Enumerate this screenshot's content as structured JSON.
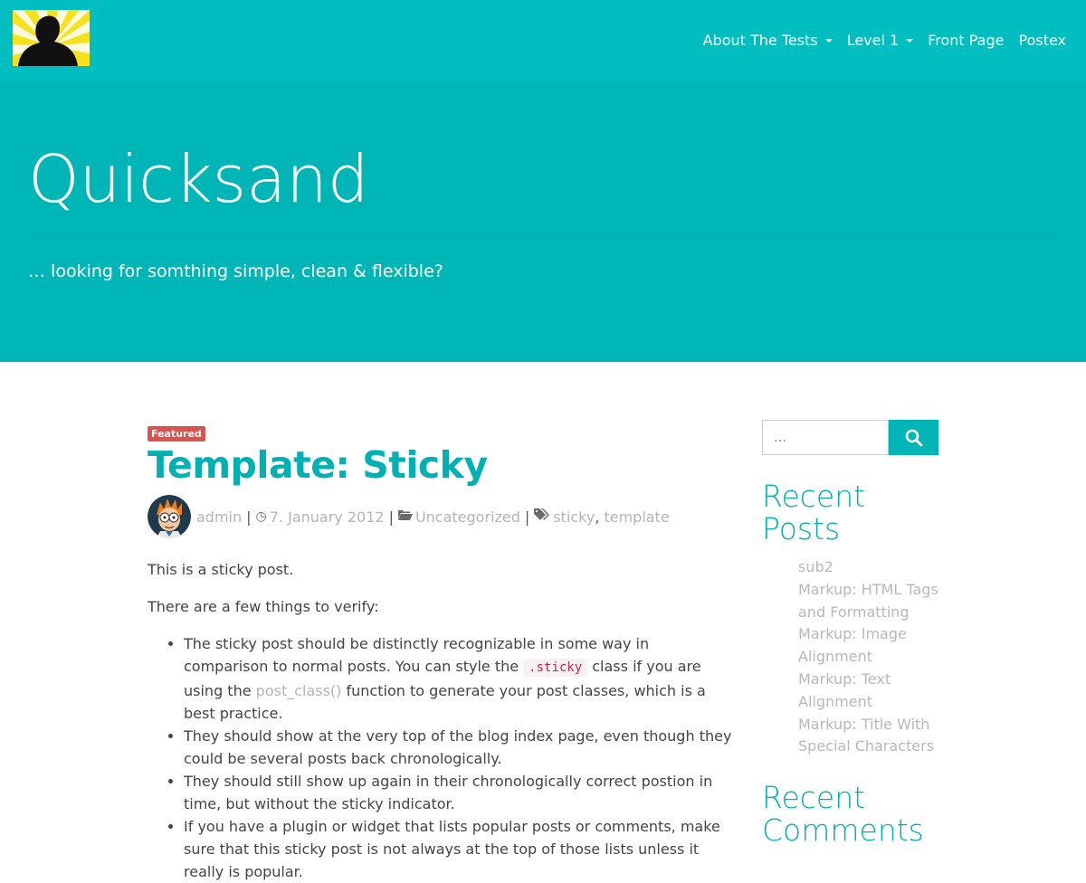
{
  "nav": {
    "items": [
      {
        "label": "About The Tests",
        "has_dropdown": true
      },
      {
        "label": "Level 1",
        "has_dropdown": true
      },
      {
        "label": "Front Page",
        "has_dropdown": false
      },
      {
        "label": "Postex",
        "has_dropdown": false
      }
    ]
  },
  "hero": {
    "title": "Quicksand",
    "tagline": "… looking for somthing simple, clean & flexible?"
  },
  "post": {
    "badge": "Featured",
    "title": "Template: Sticky",
    "author": "admin",
    "date": "7. January 2012",
    "category": "Uncategorized",
    "tags": [
      "sticky",
      "template"
    ],
    "intro": "This is a sticky post.",
    "lead": "There are a few things to verify:",
    "bullets": {
      "b1_part1": "The sticky post should be distinctly recognizable in some way in comparison to normal posts. You can style the ",
      "b1_code": ".sticky",
      "b1_part2": " class if you are using the ",
      "b1_link": "post_class()",
      "b1_part3": " function to generate your post classes, which is a best practice.",
      "b2": "They should show at the very top of the blog index page, even though they could be several posts back chronologically.",
      "b3": "They should still show up again in their chronologically correct postion in time, but without the sticky indicator.",
      "b4": "If you have a plugin or widget that lists popular posts or comments, make sure that this sticky post is not always at the top of those lists unless it really is popular."
    }
  },
  "sidebar": {
    "search_placeholder": "…",
    "recent_posts_title": "Recent Posts",
    "recent_posts": [
      "sub2",
      "Markup: HTML Tags and Formatting",
      "Markup: Image Alignment",
      "Markup: Text Alignment",
      "Markup: Title With Special Characters"
    ],
    "recent_comments_title": "Recent Comments"
  },
  "colors": {
    "navbar": "#00bdbf",
    "hero": "#00b5b6",
    "accent": "#00b0b2",
    "badge": "#d9534f"
  }
}
